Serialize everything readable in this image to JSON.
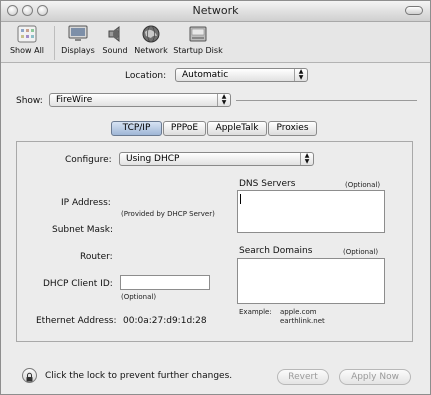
{
  "window": {
    "title": "Network"
  },
  "toolbar": {
    "show_all": "Show All",
    "displays": "Displays",
    "sound": "Sound",
    "network": "Network",
    "startup_disk": "Startup Disk"
  },
  "location": {
    "label": "Location:",
    "value": "Automatic"
  },
  "show": {
    "label": "Show:",
    "value": "FireWire"
  },
  "tabs": [
    "TCP/IP",
    "PPPoE",
    "AppleTalk",
    "Proxies"
  ],
  "tcpip": {
    "configure_label": "Configure:",
    "configure_value": "Using DHCP",
    "ip_label": "IP Address:",
    "ip_note": "(Provided by DHCP Server)",
    "subnet_label": "Subnet Mask:",
    "router_label": "Router:",
    "dhcp_label": "DHCP Client ID:",
    "dhcp_value": "",
    "dhcp_optional": "(Optional)",
    "ethernet_label": "Ethernet Address:",
    "ethernet_value": "00:0a:27:d9:1d:28",
    "dns_label": "DNS Servers",
    "dns_optional": "(Optional)",
    "dns_value": "",
    "search_label": "Search Domains",
    "search_optional": "(Optional)",
    "search_value": "",
    "example_label": "Example:",
    "example_1": "apple.com",
    "example_2": "earthlink.net"
  },
  "footer": {
    "lock_text": "Click the lock to prevent further changes.",
    "revert": "Revert",
    "apply": "Apply Now"
  },
  "icons": {
    "show_all": "show-all-icon",
    "displays": "displays-icon",
    "sound": "speaker-icon",
    "network": "globe-icon",
    "startup_disk": "disk-icon",
    "lock": "lock-icon"
  }
}
